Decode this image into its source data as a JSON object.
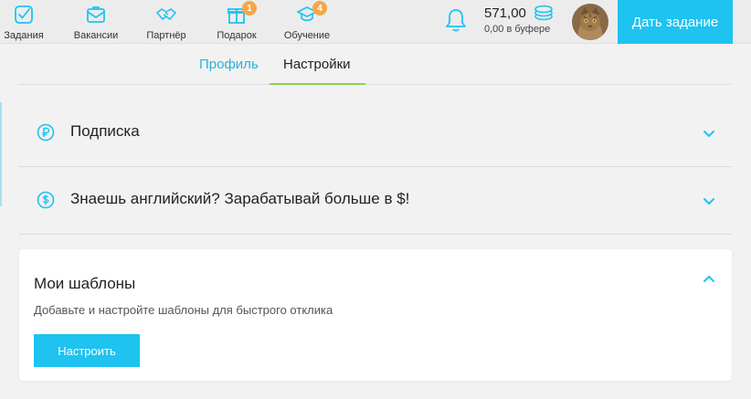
{
  "nav": {
    "items": [
      {
        "label": "Задания",
        "icon": "tasks-icon"
      },
      {
        "label": "Вакансии",
        "icon": "vacancies-icon"
      },
      {
        "label": "Партнёр",
        "icon": "partner-handshake-icon"
      },
      {
        "label": "Подарок",
        "icon": "gift-icon",
        "badge": "1"
      },
      {
        "label": "Обучение",
        "icon": "graduation-cap-icon",
        "badge": "4"
      }
    ]
  },
  "header": {
    "balance": "571,00",
    "buffer": "0,00 в буфере",
    "cta_label": "Дать задание"
  },
  "tabs": [
    {
      "label": "Профиль",
      "active": false
    },
    {
      "label": "Настройки",
      "active": true
    }
  ],
  "sections": [
    {
      "title": "Подписка",
      "icon": "ruble-circle-icon",
      "expanded": false
    },
    {
      "title": "Знаешь английский? Зарабатывай больше в $!",
      "icon": "dollar-circle-icon",
      "expanded": false
    }
  ],
  "templates_card": {
    "title": "Мои шаблоны",
    "description": "Добавьте и настройте шаблоны для быстрого отклика",
    "button_label": "Настроить",
    "expanded": true
  },
  "colors": {
    "accent": "#1ec3f0",
    "active_tab_underline": "#8fd14f",
    "badge": "#f4a64a",
    "background": "#f2f2f2"
  }
}
